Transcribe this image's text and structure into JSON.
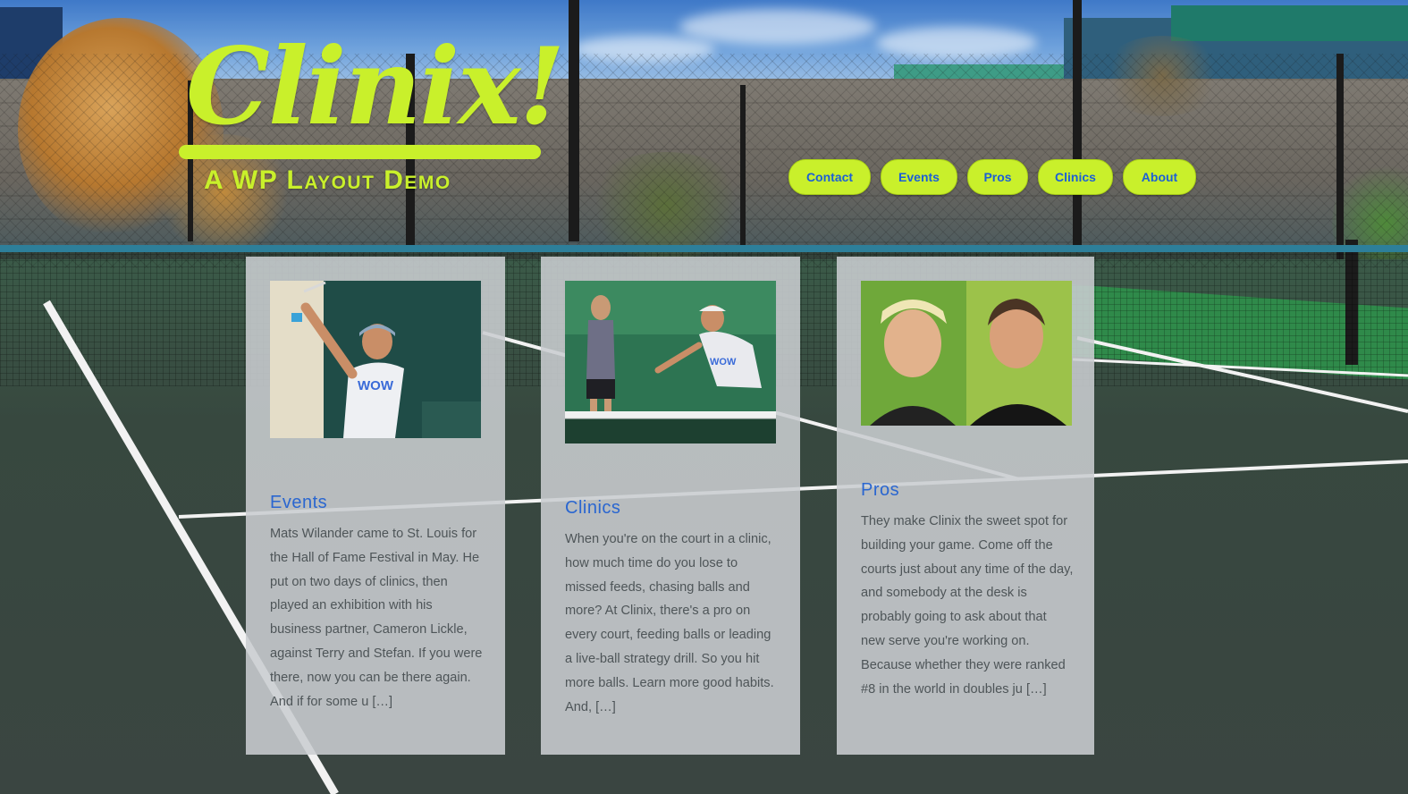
{
  "site": {
    "logo_word": "Clinix!",
    "tagline": "A WP Layout Demo"
  },
  "nav": {
    "items": [
      {
        "label": "Contact"
      },
      {
        "label": "Events"
      },
      {
        "label": "Pros"
      },
      {
        "label": "Clinics"
      },
      {
        "label": "About"
      }
    ]
  },
  "cards": [
    {
      "title": "Events",
      "text": "Mats Wilander came to St. Louis for the Hall of Fame Festival in May. He put on two days of clinics, then played an exhibition with his business partner, Cameron Lickle, against Terry and Stefan. If you were there, now you can be there again. And if for some u […]",
      "photo": "player-serving-photo"
    },
    {
      "title": "Clinics",
      "text": "When you're on the court in a clinic, how much time do you lose to missed feeds, chasing balls and more? At Clinix, there's a pro on every court, feeding balls or leading a live-ball strategy drill. So you hit more balls. Learn more good habits. And, […]",
      "photo": "clinic-coaching-photo"
    },
    {
      "title": "Pros",
      "text": "They make Clinix the sweet spot for building your game. Come off the courts just about any time of the day, and somebody at the desk is probably going to ask about that new serve you're working on. Because whether they were ranked #8 in the world in doubles ju […]",
      "photo": "pros-portrait-photo"
    }
  ],
  "colors": {
    "accent": "#c9f02b",
    "link": "#2a66d0",
    "card_bg": "#c9cdd0"
  }
}
